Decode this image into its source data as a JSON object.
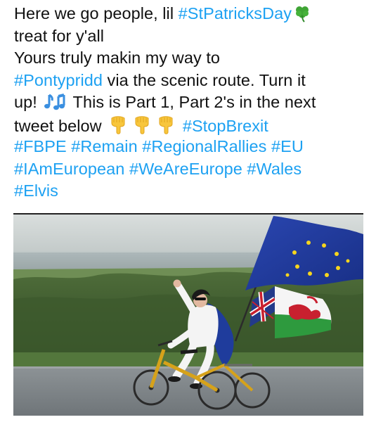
{
  "tweet": {
    "lines": [
      [
        {
          "type": "text",
          "value": "Here we go people, lil "
        },
        {
          "type": "tag",
          "value": "#StPatricksDay"
        },
        {
          "type": "emoji",
          "icon": "shamrock-icon"
        }
      ],
      [
        {
          "type": "text",
          "value": "treat for y'all"
        }
      ],
      [
        {
          "type": "text",
          "value": "Yours truly makin my way to"
        }
      ],
      [
        {
          "type": "tag",
          "value": "#Pontypridd"
        },
        {
          "type": "text",
          "value": " via the scenic route. Turn it"
        }
      ],
      [
        {
          "type": "text",
          "value": "up! "
        },
        {
          "type": "emoji",
          "icon": "music-notes-icon"
        },
        {
          "type": "text",
          "value": " This is Part 1, Part 2's in the next"
        }
      ],
      [
        {
          "type": "text",
          "value": "tweet below "
        },
        {
          "type": "emoji",
          "icon": "pointing-down-icon"
        },
        {
          "type": "emoji",
          "icon": "pointing-down-icon"
        },
        {
          "type": "emoji",
          "icon": "pointing-down-icon"
        },
        {
          "type": "text",
          "value": " "
        },
        {
          "type": "tag",
          "value": "#StopBrexit"
        }
      ],
      [
        {
          "type": "tag",
          "value": "#FBPE"
        },
        {
          "type": "text",
          "value": " "
        },
        {
          "type": "tag",
          "value": "#Remain"
        },
        {
          "type": "text",
          "value": " "
        },
        {
          "type": "tag",
          "value": "#RegionalRallies"
        },
        {
          "type": "text",
          "value": " "
        },
        {
          "type": "tag",
          "value": "#EU"
        }
      ],
      [
        {
          "type": "tag",
          "value": "#IAmEuropean"
        },
        {
          "type": "text",
          "value": " "
        },
        {
          "type": "tag",
          "value": "#WeAreEurope"
        },
        {
          "type": "text",
          "value": " "
        },
        {
          "type": "tag",
          "value": "#Wales"
        }
      ],
      [
        {
          "type": "tag",
          "value": "#Elvis"
        }
      ]
    ]
  },
  "colors": {
    "hashtag": "#1da1f2",
    "text": "#111111",
    "eu_blue": "#1f3c9c",
    "eu_star": "#f7d51d",
    "welsh_green": "#2e9a3e",
    "welsh_red": "#c8202f"
  },
  "media": {
    "kind": "video-frame",
    "icon": "video-thumbnail-image"
  }
}
